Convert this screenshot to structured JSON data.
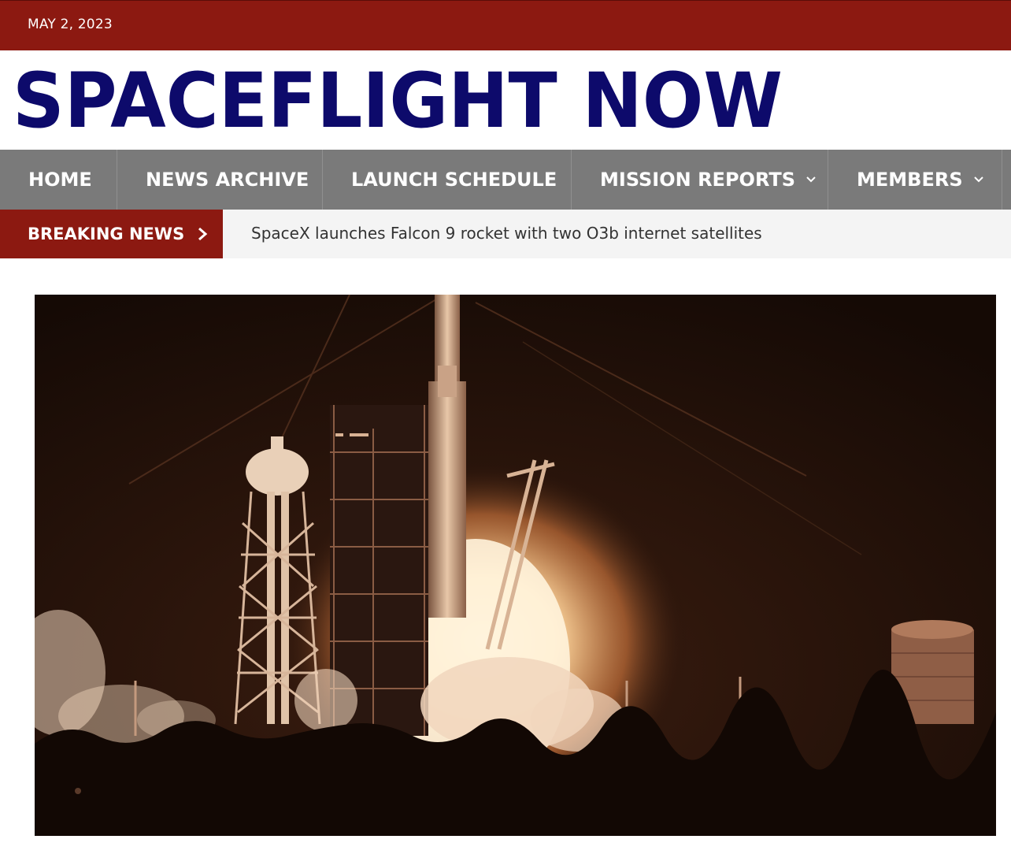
{
  "topbar": {
    "date": "MAY 2, 2023"
  },
  "masthead": {
    "logo_text": "SPACEFLIGHT NOW",
    "logo_color": "#0d0a6b"
  },
  "nav": {
    "items": [
      {
        "label": "HOME",
        "has_dropdown": false
      },
      {
        "label": "NEWS ARCHIVE",
        "has_dropdown": false
      },
      {
        "label": "LAUNCH SCHEDULE",
        "has_dropdown": false
      },
      {
        "label": "MISSION REPORTS",
        "has_dropdown": true
      },
      {
        "label": "MEMBERS",
        "has_dropdown": true
      }
    ]
  },
  "breaking": {
    "label": "BREAKING NEWS",
    "headline": "SpaceX launches Falcon 9 rocket with two O3b internet satellites"
  },
  "hero": {
    "description": "Night launch of a Falcon rocket from the pad, flame and smoke lighting the launch tower and water tower"
  },
  "colors": {
    "brand_red": "#8c1911",
    "nav_gray": "#7a7a7a",
    "logo_navy": "#0d0a6b"
  }
}
